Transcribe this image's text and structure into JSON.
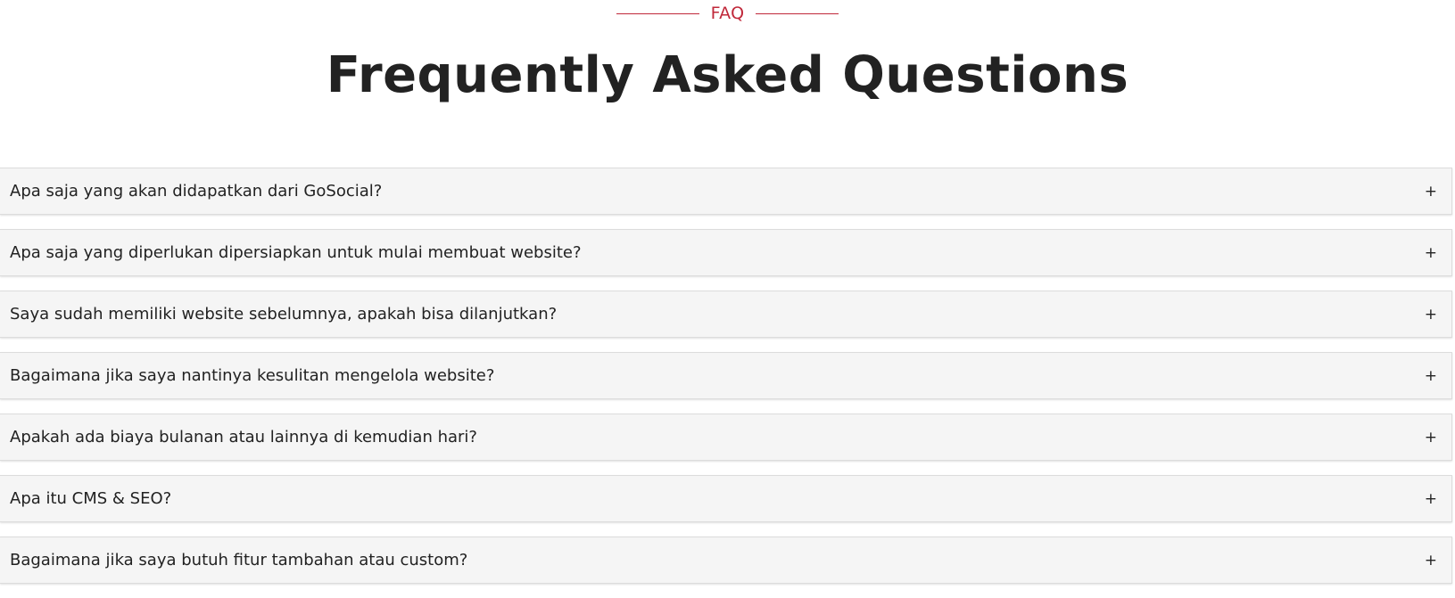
{
  "header": {
    "eyebrow": "FAQ",
    "title": "Frequently Asked Questions"
  },
  "faq": {
    "toggle_symbol": "+",
    "items": [
      {
        "question": "Apa saja yang akan didapatkan dari GoSocial?"
      },
      {
        "question": "Apa saja yang diperlukan dipersiapkan untuk mulai membuat website?"
      },
      {
        "question": "Saya sudah memiliki website sebelumnya, apakah bisa dilanjutkan?"
      },
      {
        "question": "Bagaimana jika saya nantinya kesulitan mengelola website?"
      },
      {
        "question": "Apakah ada biaya bulanan atau lainnya di kemudian hari?"
      },
      {
        "question": "Apa itu CMS & SEO?"
      },
      {
        "question": "Bagaimana jika saya butuh fitur tambahan atau custom?"
      }
    ]
  },
  "colors": {
    "accent": "#c0283a",
    "heading": "#222222",
    "item_background": "#f5f5f5"
  }
}
